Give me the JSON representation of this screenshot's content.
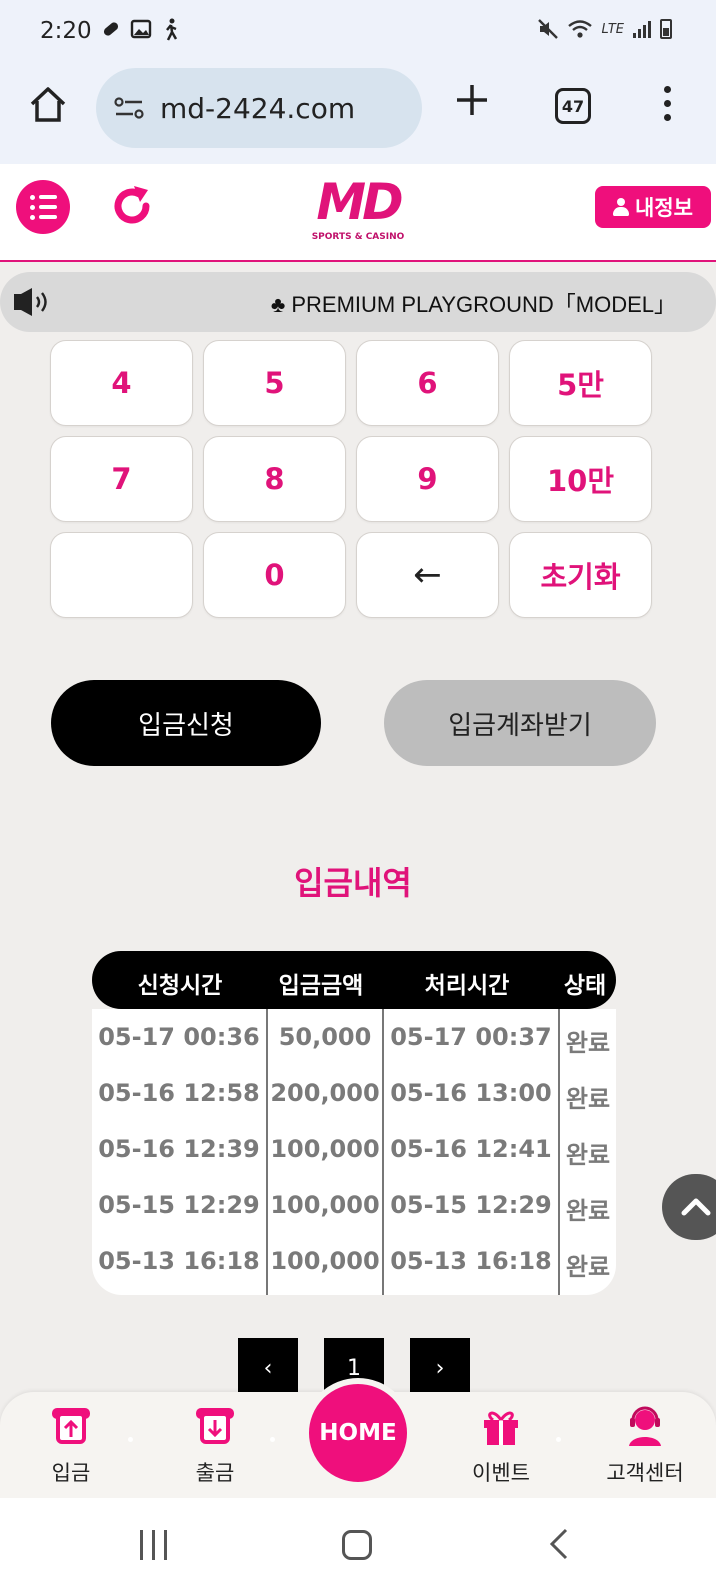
{
  "status_bar": {
    "time": "2:20",
    "lte": "LTE"
  },
  "browser": {
    "url": "md-2424.com",
    "tab_count": "47"
  },
  "header": {
    "logo_mark": "MD",
    "logo_sub": "SPORTS & CASINO",
    "myinfo_label": "내정보"
  },
  "marquee": {
    "text": "♣ PREMIUM PLAYGROUND「MODEL」"
  },
  "keypad": {
    "row1": [
      "4",
      "5",
      "6",
      "5만"
    ],
    "row2": [
      "7",
      "8",
      "9",
      "10만"
    ],
    "row3": [
      "",
      "0",
      "←",
      "초기화"
    ]
  },
  "actions": {
    "apply_label": "입금신청",
    "account_label": "입금계좌받기"
  },
  "history": {
    "title": "입금내역",
    "columns": [
      "신청시간",
      "입금금액",
      "처리시간",
      "상태"
    ],
    "rows": [
      [
        "05-17 00:36",
        "50,000",
        "05-17 00:37",
        "완료"
      ],
      [
        "05-16 12:58",
        "200,000",
        "05-16 13:00",
        "완료"
      ],
      [
        "05-16 12:39",
        "100,000",
        "05-16 12:41",
        "완료"
      ],
      [
        "05-15 12:29",
        "100,000",
        "05-15 12:29",
        "완료"
      ],
      [
        "05-13 16:18",
        "100,000",
        "05-13 16:18",
        "완료"
      ]
    ]
  },
  "pagination": {
    "prev": "‹",
    "current": "1",
    "next": "›"
  },
  "bottom_nav": {
    "deposit": "입금",
    "withdraw": "출금",
    "home": "HOME",
    "event": "이벤트",
    "support": "고객센터"
  },
  "colors": {
    "accent": "#ef0f7c",
    "accent_dark": "#e0137a",
    "background": "#f0eeec"
  }
}
